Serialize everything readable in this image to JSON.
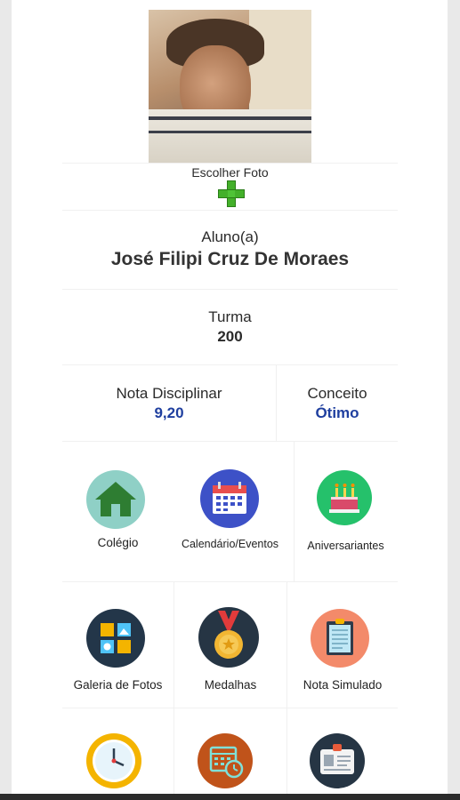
{
  "profile": {
    "choose_photo_label": "Escolher Foto"
  },
  "student": {
    "label": "Aluno(a)",
    "name": "José Filipi Cruz De Moraes"
  },
  "class": {
    "label": "Turma",
    "value": "200"
  },
  "discipline": {
    "label": "Nota Disciplinar",
    "value": "9,20"
  },
  "concept": {
    "label": "Conceito",
    "value": "Ótimo"
  },
  "menu": {
    "tiles": [
      {
        "label": "Colégio",
        "icon": "school-icon"
      },
      {
        "label": "Calendário/Eventos",
        "icon": "calendar-icon"
      },
      {
        "label": "Aniversariantes",
        "icon": "birthday-cake-icon"
      },
      {
        "label": "Galeria de Fotos",
        "icon": "photo-gallery-icon"
      },
      {
        "label": "Medalhas",
        "icon": "medal-icon"
      },
      {
        "label": "Nota Simulado",
        "icon": "clipboard-icon"
      },
      {
        "label": "",
        "icon": "clock-icon"
      },
      {
        "label": "",
        "icon": "schedule-icon"
      },
      {
        "label": "",
        "icon": "id-card-icon"
      }
    ]
  },
  "colors": {
    "accent_blue": "#1f3f9f",
    "plus_green": "#43b02a"
  }
}
